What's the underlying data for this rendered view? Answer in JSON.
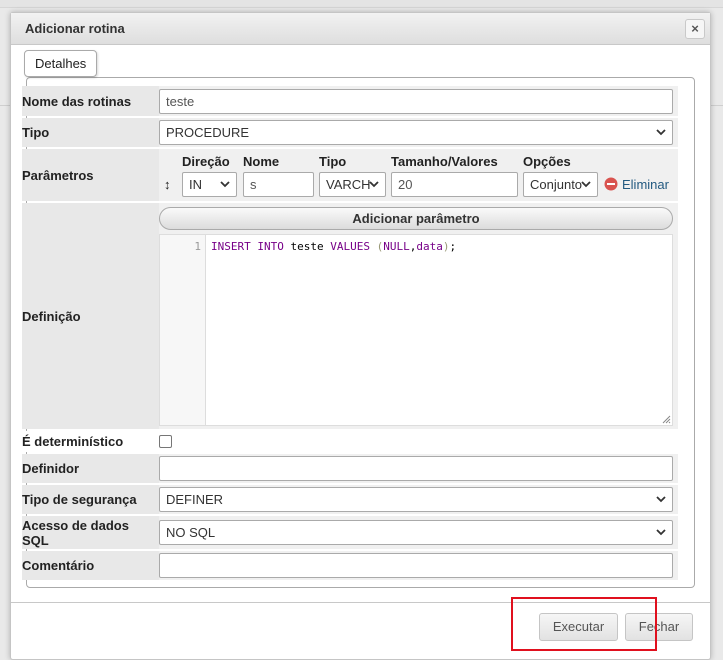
{
  "dialog": {
    "title": "Adicionar rotina",
    "close_label": "×",
    "legend": "Detalhes"
  },
  "form": {
    "routine_name": {
      "label": "Nome das rotinas",
      "value": "teste"
    },
    "type": {
      "label": "Tipo",
      "value": "PROCEDURE"
    },
    "params": {
      "label": "Parâmetros",
      "headers": [
        "Direção",
        "Nome",
        "Tipo",
        "Tamanho/Valores",
        "Opções"
      ],
      "row": {
        "sort_glyph": "↕",
        "direction": "IN",
        "name": "s",
        "type": "VARCH",
        "size": "20",
        "options": "Conjunto",
        "remove_label": "Eliminar"
      },
      "add_label": "Adicionar parâmetro"
    },
    "definition": {
      "label": "Definição",
      "line_number": "1",
      "code": {
        "kw1": "INSERT",
        "kw2": "INTO",
        "ident": "teste",
        "kw3": "VALUES",
        "open": "(",
        "kw4": "NULL",
        "comma": ",",
        "kw5": "data",
        "close": ")",
        "semi": ";"
      }
    },
    "deterministic": {
      "label": "É determinístico",
      "checked": false
    },
    "definer": {
      "label": "Definidor",
      "value": ""
    },
    "security_type": {
      "label": "Tipo de segurança",
      "value": "DEFINER"
    },
    "sql_data_access": {
      "label": "Acesso de dados SQL",
      "value": "NO SQL"
    },
    "comment": {
      "label": "Comentário",
      "value": ""
    }
  },
  "footer": {
    "execute_label": "Executar",
    "close_label": "Fechar"
  },
  "colors": {
    "highlight": "#e0101e",
    "remove_icon": "#d9534f",
    "keyword": "#770088"
  }
}
